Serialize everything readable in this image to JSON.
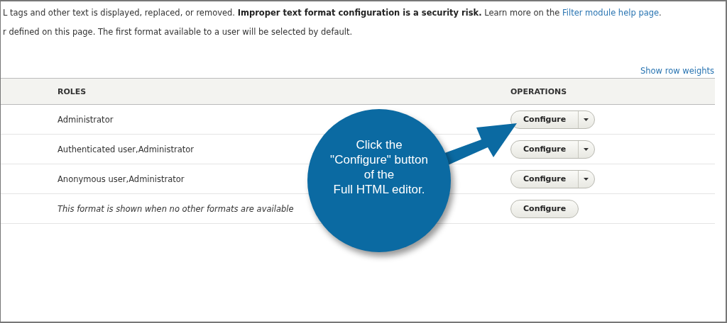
{
  "intro": {
    "line_1": {
      "text": "L tags and other text is displayed, replaced, or removed. **Improper text format configuration is a security risk.** Learn more on the ",
      "link": "Filter module help page",
      "end": "."
    },
    "line_2": "r defined on this page. The first format available to a user will be selected by default."
  },
  "show_row_weights": "Show row weights",
  "table": {
    "columns": [
      "ROLES",
      "OPERATIONS"
    ],
    "rows": [
      {
        "kind": "roles",
        "roles": "Administrator",
        "button": "Configure",
        "has_dropdown": true
      },
      {
        "kind": "roles",
        "roles": "Authenticated user,Administrator",
        "button": "Configure",
        "has_dropdown": true
      },
      {
        "kind": "roles",
        "roles": "Anonymous user,Administrator",
        "button": "Configure",
        "has_dropdown": true
      },
      {
        "kind": "note",
        "roles": "This format is shown when no other formats are available",
        "button": "Configure",
        "has_dropdown": false
      }
    ]
  },
  "callout": {
    "lines": [
      "Click the",
      "\"Configure\" button",
      "of the",
      "Full HTML editor."
    ]
  }
}
